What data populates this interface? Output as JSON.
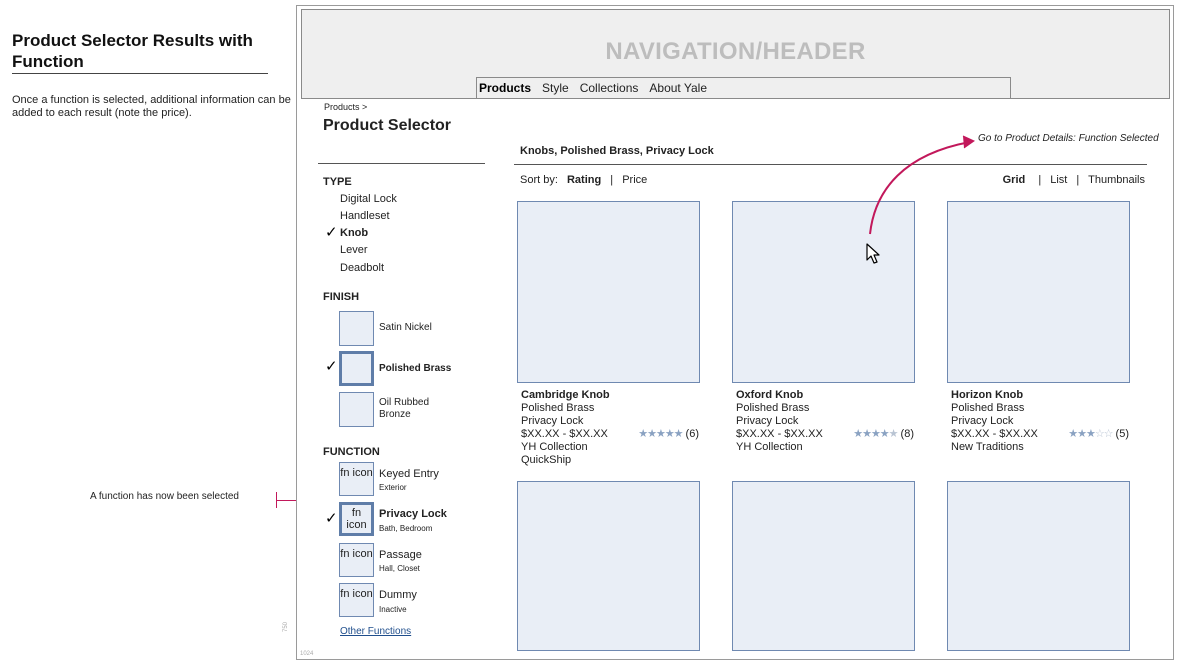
{
  "doc": {
    "title": "Product Selector Results with Function",
    "description": "Once a function is selected, additional information can be added to each result (note the price).",
    "function_note": "A function has now been selected",
    "tiny_height": "750",
    "tiny_width": "1024"
  },
  "header": {
    "title": "NAVIGATION/HEADER",
    "nav": [
      {
        "label": "Products",
        "active": true
      },
      {
        "label": "Style",
        "active": false
      },
      {
        "label": "Collections",
        "active": false
      },
      {
        "label": "About Yale",
        "active": false
      }
    ]
  },
  "breadcrumb": "Products >",
  "page_title": "Product Selector",
  "facets": {
    "type": {
      "heading": "TYPE",
      "items": [
        {
          "label": "Digital Lock",
          "selected": false
        },
        {
          "label": "Handleset",
          "selected": false
        },
        {
          "label": "Knob",
          "selected": true
        },
        {
          "label": "Lever",
          "selected": false
        },
        {
          "label": "Deadbolt",
          "selected": false
        }
      ]
    },
    "finish": {
      "heading": "FINISH",
      "items": [
        {
          "label": "Satin Nickel",
          "selected": false
        },
        {
          "label": "Polished Brass",
          "selected": true
        },
        {
          "label": "Oil Rubbed Bronze",
          "selected": false
        }
      ]
    },
    "function": {
      "heading": "FUNCTION",
      "icon_label": "fn icon",
      "items": [
        {
          "label": "Keyed Entry",
          "sub": "Exterior",
          "selected": false
        },
        {
          "label": "Privacy Lock",
          "sub": "Bath, Bedroom",
          "selected": true
        },
        {
          "label": "Passage",
          "sub": "Hall, Closet",
          "selected": false
        },
        {
          "label": "Dummy",
          "sub": "Inactive",
          "selected": false
        }
      ],
      "other_link": "Other Functions"
    }
  },
  "results": {
    "heading": "Knobs, Polished Brass, Privacy Lock",
    "sort_label": "Sort by:",
    "sort_options": [
      {
        "label": "Rating",
        "active": true
      },
      {
        "label": "Price",
        "active": false
      }
    ],
    "view_options": [
      {
        "label": "Grid",
        "active": true
      },
      {
        "label": "List",
        "active": false
      },
      {
        "label": "Thumbnails",
        "active": false
      }
    ],
    "annotation": "Go to Product Details: Function Selected",
    "products": [
      {
        "name": "Cambridge Knob",
        "finish": "Polished Brass",
        "function": "Privacy Lock",
        "price": "$XX.XX - $XX.XX",
        "rating": 5,
        "reviews": "(6)",
        "extra": [
          "YH Collection",
          "QuickShip"
        ]
      },
      {
        "name": "Oxford Knob",
        "finish": "Polished Brass",
        "function": "Privacy Lock",
        "price": "$XX.XX - $XX.XX",
        "rating": 4,
        "reviews": "(8)",
        "extra": [
          "YH Collection"
        ]
      },
      {
        "name": "Horizon Knob",
        "finish": "Polished Brass",
        "function": "Privacy Lock",
        "price": "$XX.XX - $XX.XX",
        "rating": 3,
        "reviews": "(5)",
        "extra": [
          "New Traditions"
        ]
      }
    ],
    "placeholder_rows": 1
  },
  "colors": {
    "accent_pink": "#c2185b",
    "swatch_fill": "#e9eef6",
    "swatch_border": "#6f89b1",
    "star": "#8aa2c2"
  }
}
